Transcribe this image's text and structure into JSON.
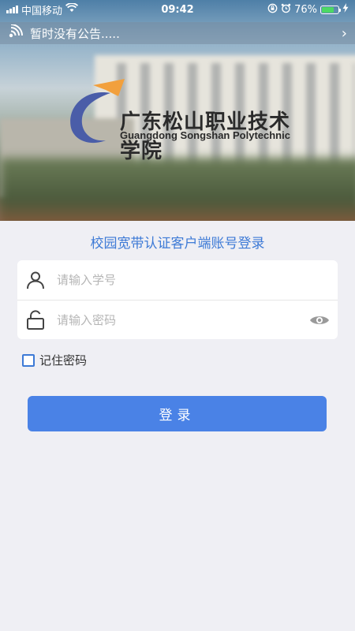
{
  "status_bar": {
    "carrier": "中国移动",
    "time": "09:42",
    "battery_percent": "76%",
    "battery_level": 0.76,
    "icons": [
      "signal-icon",
      "wifi-icon",
      "rotation-lock-icon",
      "alarm-icon",
      "battery-icon",
      "charging-icon"
    ]
  },
  "notice": {
    "text": "暂时没有公告.....",
    "icon": "broadcast-icon",
    "chevron": "›"
  },
  "logo": {
    "name_cn": "广东松山职业技术学院",
    "name_en": "Guangdong Songshan Polytechnic"
  },
  "form": {
    "title": "校园宽带认证客户端账号登录",
    "username_placeholder": "请输入学号",
    "username_value": "",
    "password_placeholder": "请输入密码",
    "password_value": "",
    "remember_label": "记住密码",
    "remember_checked": false,
    "login_label": "登录"
  },
  "colors": {
    "accent": "#3d7ad6",
    "button": "#4a82e6",
    "battery": "#4cd964",
    "background": "#efeff4"
  }
}
